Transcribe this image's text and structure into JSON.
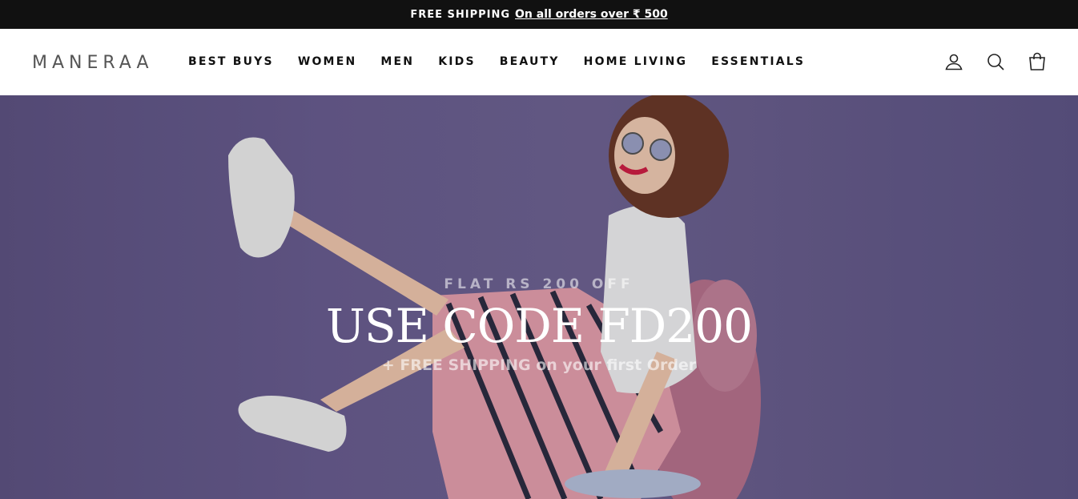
{
  "announcement": {
    "lead": "FREE SHIPPING",
    "link": "On all orders over ₹ 500"
  },
  "header": {
    "logo": "MANERAA",
    "nav": [
      "BEST BUYS",
      "WOMEN",
      "MEN",
      "KIDS",
      "BEAUTY",
      "HOME LIVING",
      "ESSENTIALS"
    ],
    "icons": [
      "account-icon",
      "search-icon",
      "cart-icon"
    ]
  },
  "hero": {
    "eyebrow": "FLAT RS 200 OFF",
    "title": "USE CODE FD200",
    "subtitle": "+ FREE SHIPPING on your first Order",
    "background_color": "#6a5e92"
  }
}
